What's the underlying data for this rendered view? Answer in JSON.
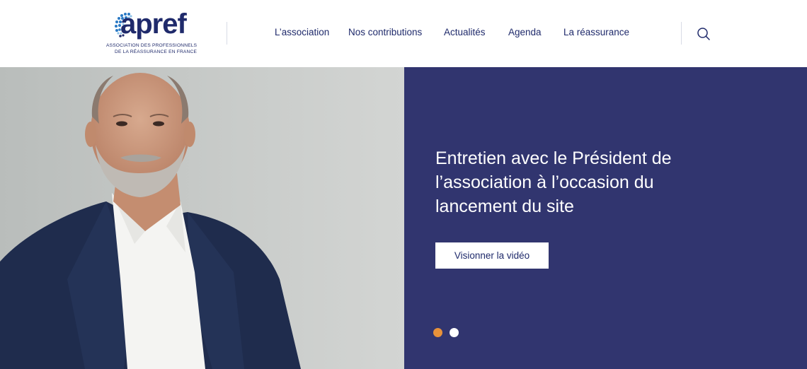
{
  "brand": {
    "name": "apref",
    "subtitle_line1": "Association des professionnels",
    "subtitle_line2": "de la réassurance en France",
    "color": "#1f2a6b"
  },
  "nav": {
    "items": [
      {
        "label": "L’association"
      },
      {
        "label": "Nos contributions"
      },
      {
        "label": "Actualités"
      },
      {
        "label": "Agenda"
      },
      {
        "label": "La réassurance"
      }
    ],
    "search_icon": "search-icon"
  },
  "hero": {
    "title": "Entretien avec le Président de l’association à l’occasion du lancement du site",
    "cta_label": "Visionner la vidéo",
    "panel_color": "#31356f",
    "slides_total": 2,
    "active_slide": 1,
    "active_dot_color": "#e8923a",
    "inactive_dot_color": "#ffffff"
  }
}
